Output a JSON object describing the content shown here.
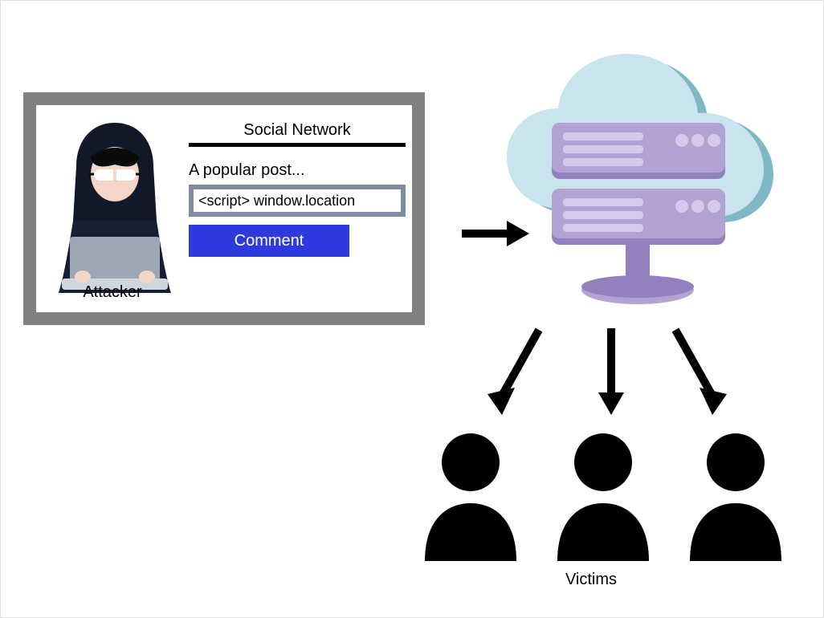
{
  "attacker": {
    "label": "Attacker",
    "post_title": "Social Network",
    "post_text": "A popular post...",
    "comment_input": "<script> window.location",
    "comment_button": "Comment"
  },
  "server": {
    "name": "cloud-server"
  },
  "victims": {
    "label": "Victims",
    "count": 3
  },
  "arrows": {
    "to_server": "arrow-right",
    "to_victims": [
      "arrow-down-left",
      "arrow-down",
      "arrow-down-right"
    ]
  },
  "colors": {
    "panel_border": "#808080",
    "button": "#2e3add",
    "input_border": "#7e8ca0",
    "cloud_light": "#c9e4ed",
    "cloud_shadow": "#7fb8c4",
    "server_body": "#b2a3d4",
    "server_dark": "#9480bd",
    "server_lines": "#d5cae9"
  }
}
